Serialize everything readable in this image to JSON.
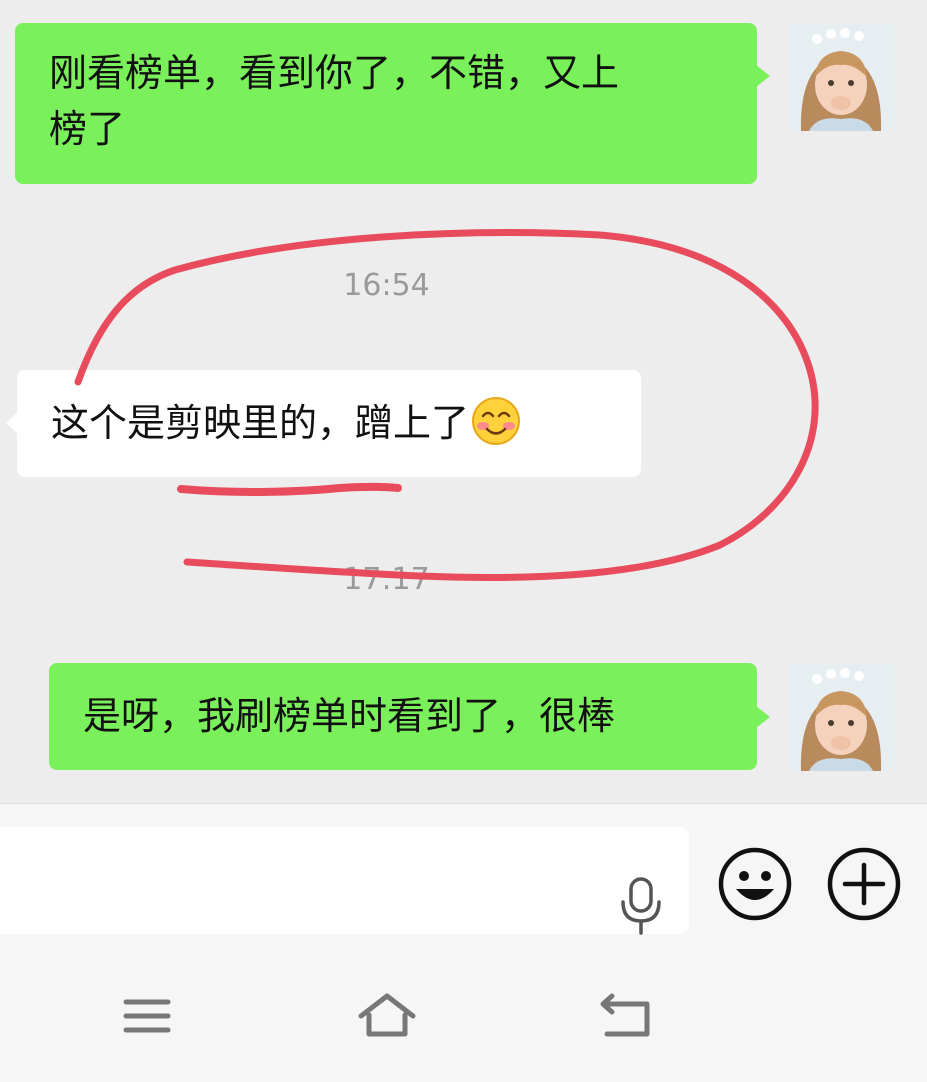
{
  "messages": [
    {
      "direction": "outgoing",
      "text_line1": "刚看榜单，看到你了，不错，又上",
      "text_line2": "榜了",
      "avatar": "avatar-girl"
    },
    {
      "type": "timestamp",
      "text": "16:54"
    },
    {
      "direction": "incoming",
      "text": "这个是剪映里的，蹭上了",
      "emoji": "smiling-face-with-blush-emoji"
    },
    {
      "type": "timestamp",
      "text": "17:17"
    },
    {
      "direction": "outgoing",
      "text": "是呀，我刷榜单时看到了，很棒",
      "avatar": "avatar-girl"
    }
  ],
  "annotation": {
    "color": "#e84c5c",
    "shapes": [
      "circle-stroke",
      "underline-stroke"
    ]
  },
  "input_bar": {
    "icons": [
      "microphone-icon",
      "emoji-icon",
      "plus-icon"
    ],
    "bubble_colors": {
      "outgoing": "#7af05a",
      "incoming": "#ffffff"
    }
  },
  "navigation_bar": {
    "icons": [
      "menu-icon",
      "home-icon",
      "back-icon"
    ]
  }
}
